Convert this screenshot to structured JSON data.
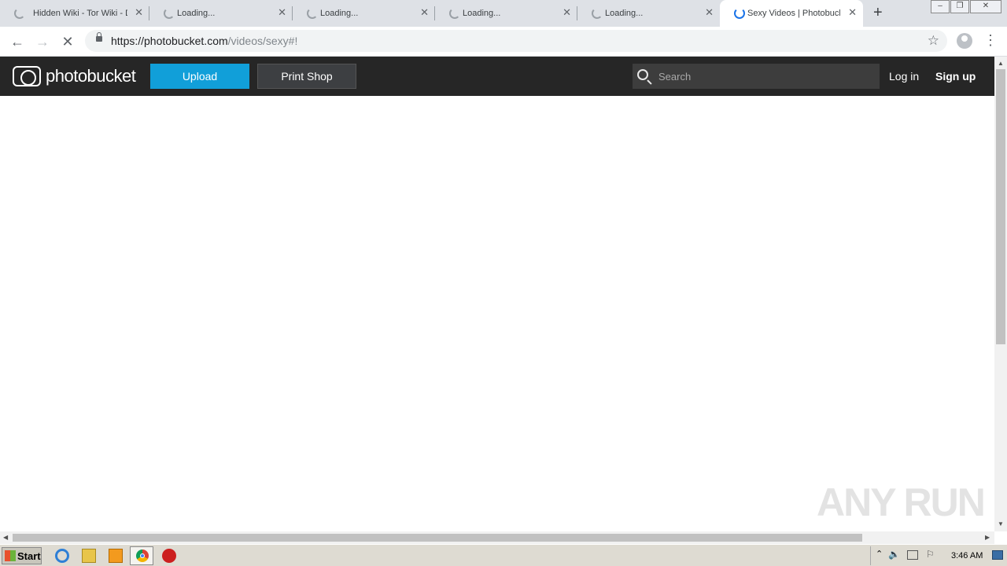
{
  "browser": {
    "tabs": [
      {
        "title": "Hidden Wiki - Tor Wiki - D",
        "active": false
      },
      {
        "title": "Loading...",
        "active": false
      },
      {
        "title": "Loading...",
        "active": false
      },
      {
        "title": "Loading...",
        "active": false
      },
      {
        "title": "Loading...",
        "active": false
      },
      {
        "title": "Sexy Videos | Photobuck",
        "active": true
      }
    ],
    "url_host": "https://photobucket.com",
    "url_path": "/videos/sexy#!"
  },
  "site": {
    "logo_text": "photobucket",
    "upload_label": "Upload",
    "printshop_label": "Print Shop",
    "search_placeholder": "Search",
    "login_label": "Log in",
    "signup_label": "Sign up"
  },
  "watermark": "ANY RUN",
  "taskbar": {
    "start_label": "Start",
    "clock": "3:46 AM"
  },
  "colors": {
    "accent": "#119fd9",
    "header_bg": "#262626"
  }
}
